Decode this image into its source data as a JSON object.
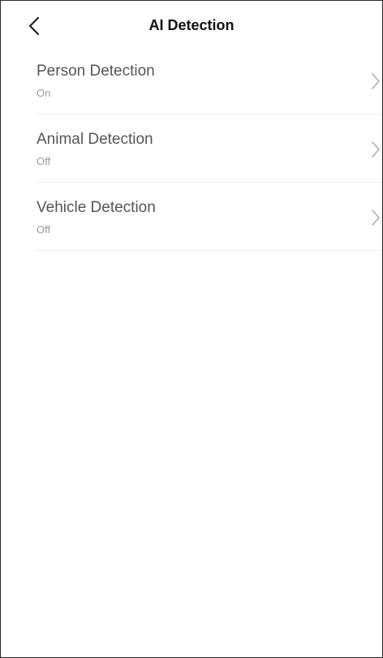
{
  "header": {
    "title": "AI Detection",
    "back_icon": "chevron-left-icon"
  },
  "detections": [
    {
      "label": "Person Detection",
      "status": "On"
    },
    {
      "label": "Animal Detection",
      "status": "Off"
    },
    {
      "label": "Vehicle Detection",
      "status": "Off"
    }
  ],
  "colors": {
    "title": "#111111",
    "item_label": "#555555",
    "item_status": "#9a9a9a",
    "divider": "#ececec",
    "chevron": "#aaaaaa"
  }
}
